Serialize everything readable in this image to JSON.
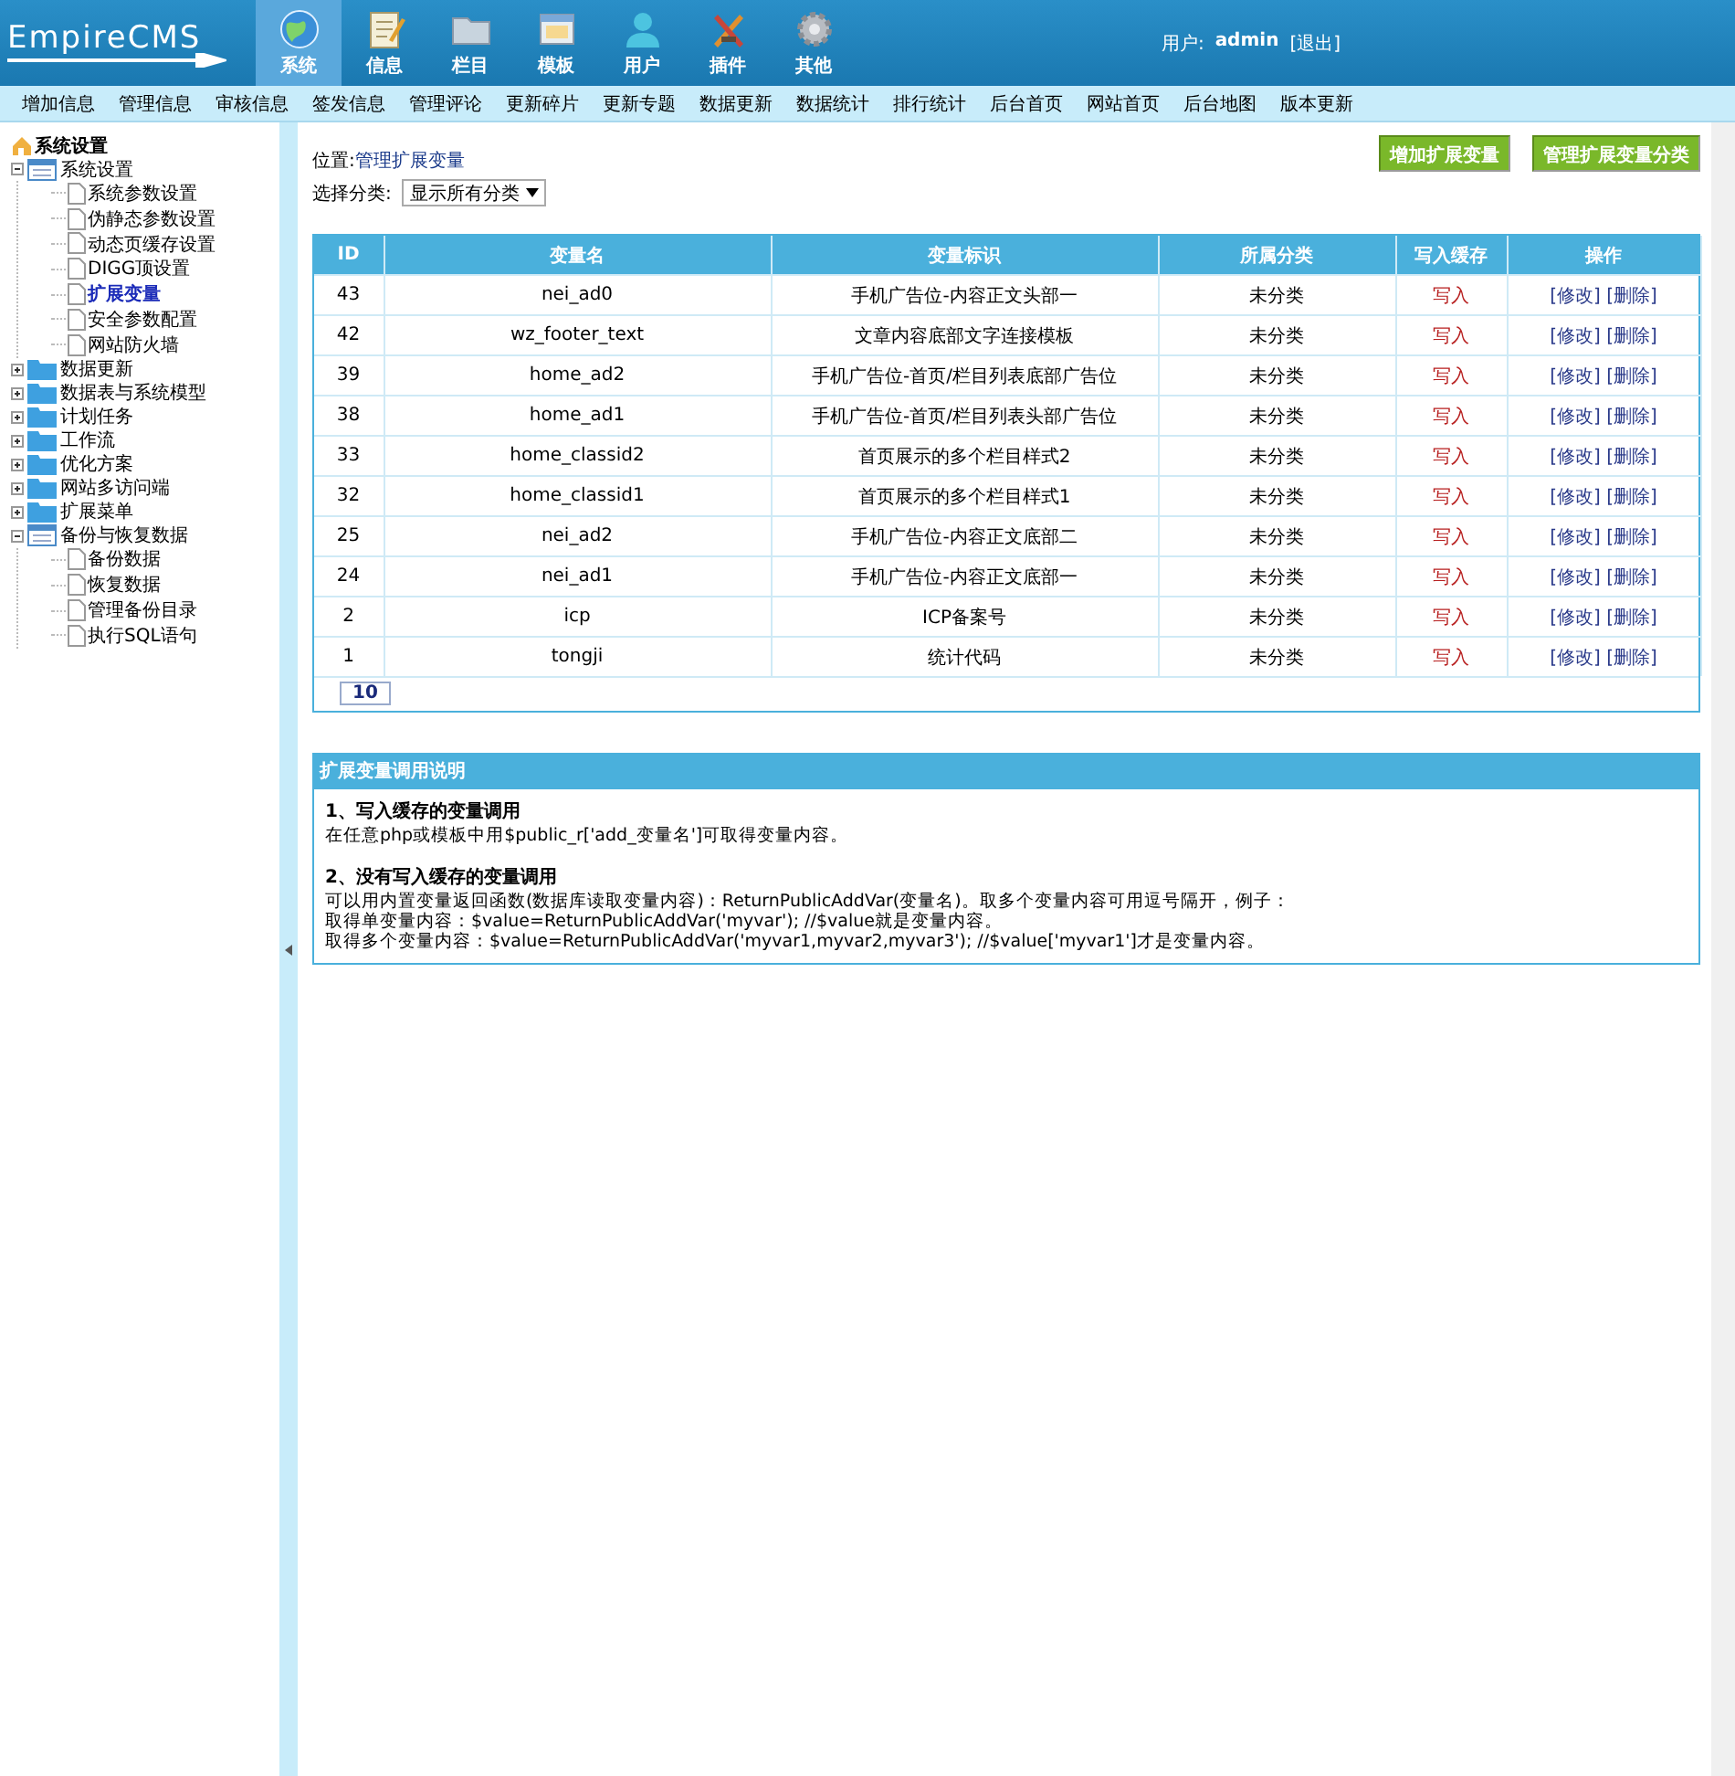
{
  "logo": {
    "text": "EmpireCMS"
  },
  "nav_tabs": [
    {
      "label": "系统",
      "kind": "globe",
      "selected": true
    },
    {
      "label": "信息",
      "kind": "note",
      "selected": false
    },
    {
      "label": "栏目",
      "kind": "folder",
      "selected": false
    },
    {
      "label": "模板",
      "kind": "window",
      "selected": false
    },
    {
      "label": "用户",
      "kind": "user",
      "selected": false
    },
    {
      "label": "插件",
      "kind": "tools",
      "selected": false
    },
    {
      "label": "其他",
      "kind": "gear",
      "selected": false
    }
  ],
  "user": {
    "label": "用户:",
    "name": "admin",
    "logout": "[退出]"
  },
  "submenu": [
    "增加信息",
    "管理信息",
    "审核信息",
    "签发信息",
    "管理评论",
    "更新碎片",
    "更新专题",
    "数据更新",
    "数据统计",
    "排行统计",
    "后台首页",
    "网站首页",
    "后台地图",
    "版本更新"
  ],
  "sidebar": {
    "title": "系统设置",
    "tree": [
      {
        "label": "系统设置",
        "expanded": true,
        "children": [
          {
            "label": "系统参数设置",
            "selected": false
          },
          {
            "label": "伪静态参数设置",
            "selected": false
          },
          {
            "label": "动态页缓存设置",
            "selected": false
          },
          {
            "label": "DIGG顶设置",
            "selected": false
          },
          {
            "label": "扩展变量",
            "selected": true
          },
          {
            "label": "安全参数配置",
            "selected": false
          },
          {
            "label": "网站防火墙",
            "selected": false
          }
        ]
      },
      {
        "label": "数据更新",
        "expanded": false
      },
      {
        "label": "数据表与系统模型",
        "expanded": false
      },
      {
        "label": "计划任务",
        "expanded": false
      },
      {
        "label": "工作流",
        "expanded": false
      },
      {
        "label": "优化方案",
        "expanded": false
      },
      {
        "label": "网站多访问端",
        "expanded": false
      },
      {
        "label": "扩展菜单",
        "expanded": false
      },
      {
        "label": "备份与恢复数据",
        "expanded": true,
        "children": [
          {
            "label": "备份数据",
            "selected": false
          },
          {
            "label": "恢复数据",
            "selected": false
          },
          {
            "label": "管理备份目录",
            "selected": false
          },
          {
            "label": "执行SQL语句",
            "selected": false
          }
        ]
      }
    ]
  },
  "breadcrumb": {
    "label": "位置:",
    "link": "管理扩展变量"
  },
  "buttons": [
    "增加扩展变量",
    "管理扩展变量分类"
  ],
  "filter": {
    "label": "选择分类:",
    "value": "显示所有分类"
  },
  "table": {
    "columns": [
      "ID",
      "变量名",
      "变量标识",
      "所属分类",
      "写入缓存",
      "操作"
    ],
    "rows": [
      {
        "id": "43",
        "name": "nei_ad0",
        "title": "手机广告位-内容正文头部一",
        "category": "未分类",
        "cache": "写入",
        "edit": "[修改]",
        "delete": "[删除]"
      },
      {
        "id": "42",
        "name": "wz_footer_text",
        "title": "文章内容底部文字连接模板",
        "category": "未分类",
        "cache": "写入",
        "edit": "[修改]",
        "delete": "[删除]"
      },
      {
        "id": "39",
        "name": "home_ad2",
        "title": "手机广告位-首页/栏目列表底部广告位",
        "category": "未分类",
        "cache": "写入",
        "edit": "[修改]",
        "delete": "[删除]"
      },
      {
        "id": "38",
        "name": "home_ad1",
        "title": "手机广告位-首页/栏目列表头部广告位",
        "category": "未分类",
        "cache": "写入",
        "edit": "[修改]",
        "delete": "[删除]"
      },
      {
        "id": "33",
        "name": "home_classid2",
        "title": "首页展示的多个栏目样式2",
        "category": "未分类",
        "cache": "写入",
        "edit": "[修改]",
        "delete": "[删除]"
      },
      {
        "id": "32",
        "name": "home_classid1",
        "title": "首页展示的多个栏目样式1",
        "category": "未分类",
        "cache": "写入",
        "edit": "[修改]",
        "delete": "[删除]"
      },
      {
        "id": "25",
        "name": "nei_ad2",
        "title": "手机广告位-内容正文底部二",
        "category": "未分类",
        "cache": "写入",
        "edit": "[修改]",
        "delete": "[删除]"
      },
      {
        "id": "24",
        "name": "nei_ad1",
        "title": "手机广告位-内容正文底部一",
        "category": "未分类",
        "cache": "写入",
        "edit": "[修改]",
        "delete": "[删除]"
      },
      {
        "id": "2",
        "name": "icp",
        "title": "ICP备案号",
        "category": "未分类",
        "cache": "写入",
        "edit": "[修改]",
        "delete": "[删除]"
      },
      {
        "id": "1",
        "name": "tongji",
        "title": "统计代码",
        "category": "未分类",
        "cache": "写入",
        "edit": "[修改]",
        "delete": "[删除]"
      }
    ],
    "pagination": "10"
  },
  "help": {
    "title": "扩展变量调用说明",
    "sections": [
      {
        "heading": "1、写入缓存的变量调用",
        "lines": [
          "在任意php或模板中用$public_r['add_变量名']可取得变量内容。"
        ]
      },
      {
        "heading": "2、没有写入缓存的变量调用",
        "lines": [
          "可以用内置变量返回函数(数据库读取变量内容)：ReturnPublicAddVar(变量名)。取多个变量内容可用逗号隔开，例子：",
          "取得单变量内容：$value=ReturnPublicAddVar('myvar'); //$value就是变量内容。",
          "取得多个变量内容：$value=ReturnPublicAddVar('myvar1,myvar2,myvar3'); //$value['myvar1']才是变量内容。"
        ]
      }
    ]
  }
}
